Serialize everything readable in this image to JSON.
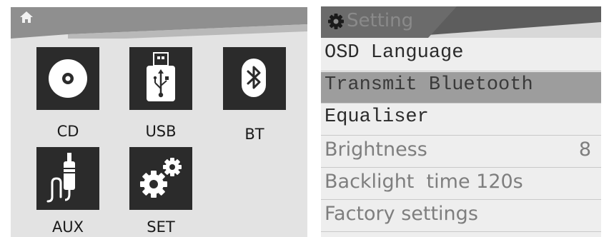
{
  "home_screen": {
    "home_icon": "home-icon",
    "tiles": [
      {
        "label": "CD",
        "icon": "disc-icon"
      },
      {
        "label": "USB",
        "icon": "usb-icon"
      },
      {
        "label": "BT",
        "icon": "bluetooth-icon"
      },
      {
        "label": "AUX",
        "icon": "aux-cable-icon"
      },
      {
        "label": "SET",
        "icon": "gears-icon"
      }
    ]
  },
  "settings_screen": {
    "title": "Setting",
    "title_icon": "gear-icon",
    "items": [
      {
        "label": "OSD Language",
        "value": ""
      },
      {
        "label": "Transmit Bluetooth",
        "value": "",
        "selected": true
      },
      {
        "label": "Equaliser",
        "value": ""
      },
      {
        "label": "Brightness",
        "value": "8"
      },
      {
        "label": "Backlight  time 120s",
        "value": ""
      },
      {
        "label": "Factory settings",
        "value": ""
      }
    ]
  },
  "colors": {
    "tile_bg": "#2b2b2b",
    "panel_bg": "#e3e3e3",
    "selected_row": "#9d9d9d"
  }
}
